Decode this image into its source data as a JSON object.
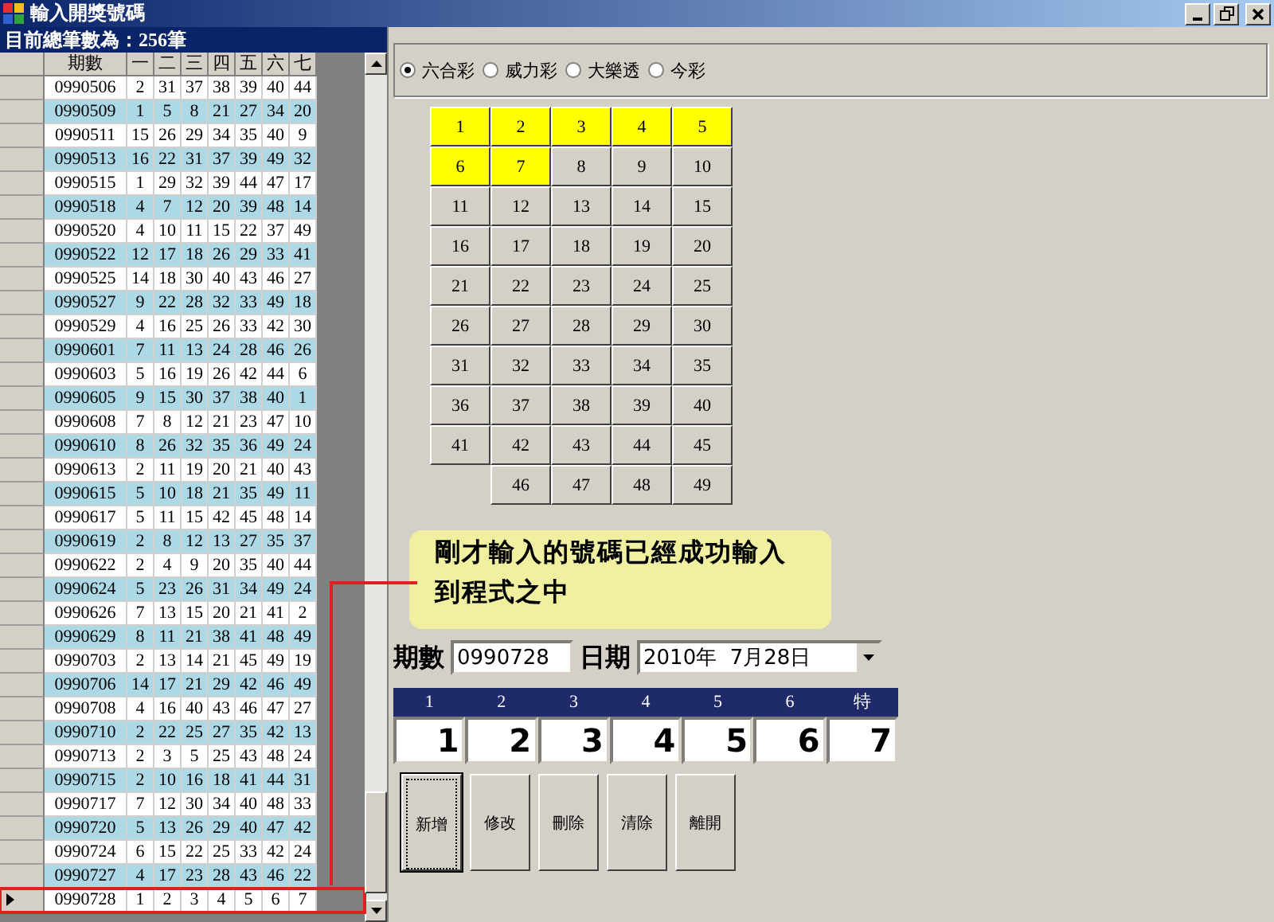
{
  "window": {
    "title": "輸入開獎號碼"
  },
  "summary": "目前總筆數為：256筆",
  "table": {
    "columns": [
      "期數",
      "一",
      "二",
      "三",
      "四",
      "五",
      "六",
      "七"
    ],
    "rows": [
      {
        "period": "0990506",
        "numbers": [
          "2",
          "31",
          "37",
          "38",
          "39",
          "40",
          "44"
        ],
        "selected": false
      },
      {
        "period": "0990509",
        "numbers": [
          "1",
          "5",
          "8",
          "21",
          "27",
          "34",
          "20"
        ],
        "selected": false
      },
      {
        "period": "0990511",
        "numbers": [
          "15",
          "26",
          "29",
          "34",
          "35",
          "40",
          "9"
        ],
        "selected": false
      },
      {
        "period": "0990513",
        "numbers": [
          "16",
          "22",
          "31",
          "37",
          "39",
          "49",
          "32"
        ],
        "selected": false
      },
      {
        "period": "0990515",
        "numbers": [
          "1",
          "29",
          "32",
          "39",
          "44",
          "47",
          "17"
        ],
        "selected": false
      },
      {
        "period": "0990518",
        "numbers": [
          "4",
          "7",
          "12",
          "20",
          "39",
          "48",
          "14"
        ],
        "selected": false
      },
      {
        "period": "0990520",
        "numbers": [
          "4",
          "10",
          "11",
          "15",
          "22",
          "37",
          "49"
        ],
        "selected": false
      },
      {
        "period": "0990522",
        "numbers": [
          "12",
          "17",
          "18",
          "26",
          "29",
          "33",
          "41"
        ],
        "selected": false
      },
      {
        "period": "0990525",
        "numbers": [
          "14",
          "18",
          "30",
          "40",
          "43",
          "46",
          "27"
        ],
        "selected": false
      },
      {
        "period": "0990527",
        "numbers": [
          "9",
          "22",
          "28",
          "32",
          "33",
          "49",
          "18"
        ],
        "selected": false
      },
      {
        "period": "0990529",
        "numbers": [
          "4",
          "16",
          "25",
          "26",
          "33",
          "42",
          "30"
        ],
        "selected": false
      },
      {
        "period": "0990601",
        "numbers": [
          "7",
          "11",
          "13",
          "24",
          "28",
          "46",
          "26"
        ],
        "selected": false
      },
      {
        "period": "0990603",
        "numbers": [
          "5",
          "16",
          "19",
          "26",
          "42",
          "44",
          "6"
        ],
        "selected": false
      },
      {
        "period": "0990605",
        "numbers": [
          "9",
          "15",
          "30",
          "37",
          "38",
          "40",
          "1"
        ],
        "selected": false
      },
      {
        "period": "0990608",
        "numbers": [
          "7",
          "8",
          "12",
          "21",
          "23",
          "47",
          "10"
        ],
        "selected": false
      },
      {
        "period": "0990610",
        "numbers": [
          "8",
          "26",
          "32",
          "35",
          "36",
          "49",
          "24"
        ],
        "selected": false
      },
      {
        "period": "0990613",
        "numbers": [
          "2",
          "11",
          "19",
          "20",
          "21",
          "40",
          "43"
        ],
        "selected": false
      },
      {
        "period": "0990615",
        "numbers": [
          "5",
          "10",
          "18",
          "21",
          "35",
          "49",
          "11"
        ],
        "selected": false
      },
      {
        "period": "0990617",
        "numbers": [
          "5",
          "11",
          "15",
          "42",
          "45",
          "48",
          "14"
        ],
        "selected": false
      },
      {
        "period": "0990619",
        "numbers": [
          "2",
          "8",
          "12",
          "13",
          "27",
          "35",
          "37"
        ],
        "selected": false
      },
      {
        "period": "0990622",
        "numbers": [
          "2",
          "4",
          "9",
          "20",
          "35",
          "40",
          "44"
        ],
        "selected": false
      },
      {
        "period": "0990624",
        "numbers": [
          "5",
          "23",
          "26",
          "31",
          "34",
          "49",
          "24"
        ],
        "selected": false
      },
      {
        "period": "0990626",
        "numbers": [
          "7",
          "13",
          "15",
          "20",
          "21",
          "41",
          "2"
        ],
        "selected": false
      },
      {
        "period": "0990629",
        "numbers": [
          "8",
          "11",
          "21",
          "38",
          "41",
          "48",
          "49"
        ],
        "selected": false
      },
      {
        "period": "0990703",
        "numbers": [
          "2",
          "13",
          "14",
          "21",
          "45",
          "49",
          "19"
        ],
        "selected": false
      },
      {
        "period": "0990706",
        "numbers": [
          "14",
          "17",
          "21",
          "29",
          "42",
          "46",
          "49"
        ],
        "selected": false
      },
      {
        "period": "0990708",
        "numbers": [
          "4",
          "16",
          "40",
          "43",
          "46",
          "47",
          "27"
        ],
        "selected": false
      },
      {
        "period": "0990710",
        "numbers": [
          "2",
          "22",
          "25",
          "27",
          "35",
          "42",
          "13"
        ],
        "selected": false
      },
      {
        "period": "0990713",
        "numbers": [
          "2",
          "3",
          "5",
          "25",
          "43",
          "48",
          "24"
        ],
        "selected": false
      },
      {
        "period": "0990715",
        "numbers": [
          "2",
          "10",
          "16",
          "18",
          "41",
          "44",
          "31"
        ],
        "selected": false
      },
      {
        "period": "0990717",
        "numbers": [
          "7",
          "12",
          "30",
          "34",
          "40",
          "48",
          "33"
        ],
        "selected": false
      },
      {
        "period": "0990720",
        "numbers": [
          "5",
          "13",
          "26",
          "29",
          "40",
          "47",
          "42"
        ],
        "selected": false
      },
      {
        "period": "0990724",
        "numbers": [
          "6",
          "15",
          "22",
          "25",
          "33",
          "42",
          "24"
        ],
        "selected": false
      },
      {
        "period": "0990727",
        "numbers": [
          "4",
          "17",
          "23",
          "28",
          "43",
          "46",
          "22"
        ],
        "selected": false
      },
      {
        "period": "0990728",
        "numbers": [
          "1",
          "2",
          "3",
          "4",
          "5",
          "6",
          "7"
        ],
        "selected": true
      }
    ]
  },
  "lottery_types": [
    {
      "label": "六合彩",
      "selected": true
    },
    {
      "label": "威力彩",
      "selected": false
    },
    {
      "label": "大樂透",
      "selected": false
    },
    {
      "label": "今彩",
      "selected": false
    }
  ],
  "number_grid": [
    {
      "label": "1",
      "selected": true
    },
    {
      "label": "2",
      "selected": true
    },
    {
      "label": "3",
      "selected": true
    },
    {
      "label": "4",
      "selected": true
    },
    {
      "label": "5",
      "selected": true
    },
    {
      "label": "6",
      "selected": true
    },
    {
      "label": "7",
      "selected": true
    },
    {
      "label": "8",
      "selected": false
    },
    {
      "label": "9",
      "selected": false
    },
    {
      "label": "10",
      "selected": false
    },
    {
      "label": "11",
      "selected": false
    },
    {
      "label": "12",
      "selected": false
    },
    {
      "label": "13",
      "selected": false
    },
    {
      "label": "14",
      "selected": false
    },
    {
      "label": "15",
      "selected": false
    },
    {
      "label": "16",
      "selected": false
    },
    {
      "label": "17",
      "selected": false
    },
    {
      "label": "18",
      "selected": false
    },
    {
      "label": "19",
      "selected": false
    },
    {
      "label": "20",
      "selected": false
    },
    {
      "label": "21",
      "selected": false
    },
    {
      "label": "22",
      "selected": false
    },
    {
      "label": "23",
      "selected": false
    },
    {
      "label": "24",
      "selected": false
    },
    {
      "label": "25",
      "selected": false
    },
    {
      "label": "26",
      "selected": false
    },
    {
      "label": "27",
      "selected": false
    },
    {
      "label": "28",
      "selected": false
    },
    {
      "label": "29",
      "selected": false
    },
    {
      "label": "30",
      "selected": false
    },
    {
      "label": "31",
      "selected": false
    },
    {
      "label": "32",
      "selected": false
    },
    {
      "label": "33",
      "selected": false
    },
    {
      "label": "34",
      "selected": false
    },
    {
      "label": "35",
      "selected": false
    },
    {
      "label": "36",
      "selected": false
    },
    {
      "label": "37",
      "selected": false
    },
    {
      "label": "38",
      "selected": false
    },
    {
      "label": "39",
      "selected": false
    },
    {
      "label": "40",
      "selected": false
    },
    {
      "label": "41",
      "selected": false
    },
    {
      "label": "42",
      "selected": false
    },
    {
      "label": "43",
      "selected": false
    },
    {
      "label": "44",
      "selected": false
    },
    {
      "label": "45",
      "selected": false
    },
    {
      "label": "46",
      "selected": false
    },
    {
      "label": "47",
      "selected": false
    },
    {
      "label": "48",
      "selected": false
    },
    {
      "label": "49",
      "selected": false
    }
  ],
  "annotation": "剛才輸入的號碼已經成功輸入到程式之中",
  "form": {
    "period_label": "期數",
    "period_value": "0990728",
    "date_label": "日期",
    "date_value": "2010年  7月28日"
  },
  "number_entry": {
    "headers": [
      "1",
      "2",
      "3",
      "4",
      "5",
      "6",
      "特"
    ],
    "values": [
      "1",
      "2",
      "3",
      "4",
      "5",
      "6",
      "7"
    ]
  },
  "buttons": [
    {
      "label": "新增",
      "focused": true
    },
    {
      "label": "修改",
      "focused": false
    },
    {
      "label": "刪除",
      "focused": false
    },
    {
      "label": "清除",
      "focused": false
    },
    {
      "label": "離開",
      "focused": false
    }
  ]
}
